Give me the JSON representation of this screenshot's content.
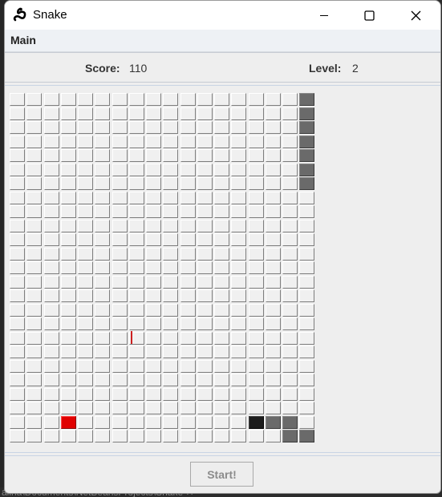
{
  "window": {
    "title": "Snake",
    "app_icon": "snake-icon",
    "controls": [
      "minimize-icon",
      "maximize-icon",
      "close-icon"
    ]
  },
  "menu": {
    "items": [
      {
        "label": "Main"
      }
    ]
  },
  "status": {
    "score_label": "Score:",
    "score_value": "110",
    "level_label": "Level:",
    "level_value": "2"
  },
  "board": {
    "columns": 18,
    "rows": 25,
    "snake_body": [
      [
        17,
        0
      ],
      [
        17,
        1
      ],
      [
        17,
        2
      ],
      [
        17,
        3
      ],
      [
        17,
        4
      ],
      [
        17,
        5
      ],
      [
        17,
        6
      ],
      [
        15,
        23
      ],
      [
        16,
        23
      ],
      [
        16,
        24
      ],
      [
        17,
        24
      ]
    ],
    "snake_head": [
      14,
      23
    ],
    "food": [
      3,
      23
    ],
    "colors": {
      "cell": "#f0f0f0",
      "snake": "#6a6a6a",
      "head": "#1c1c1c",
      "food": "#e00000"
    }
  },
  "actions": {
    "start_label": "Start!"
  },
  "background": {
    "partial_text": "alina\\Documents\\NetBeansProjects\\Snake   ✕"
  }
}
